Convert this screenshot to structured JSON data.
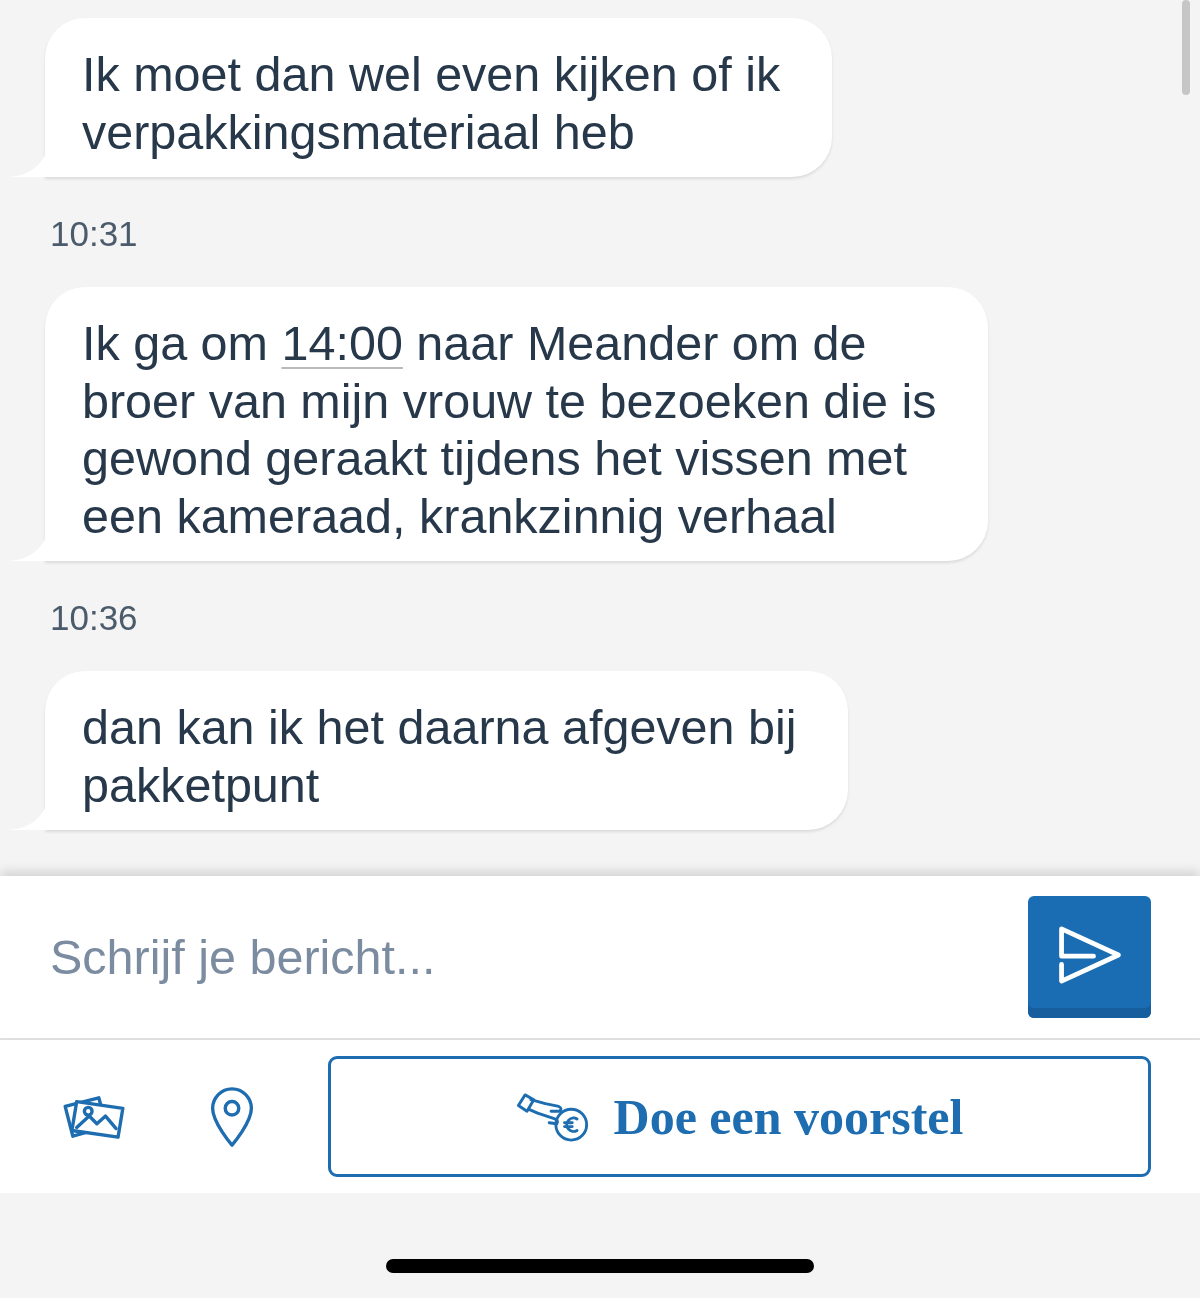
{
  "messages": [
    {
      "kind": "bubble",
      "parts": [
        {
          "kind": "text",
          "text": "Ik moet dan wel even kijken of ik verpakkingsmateriaal heb"
        }
      ]
    },
    {
      "kind": "time",
      "text": "10:31"
    },
    {
      "kind": "bubble",
      "parts": [
        {
          "kind": "text",
          "text": "Ik ga om "
        },
        {
          "kind": "link",
          "text": "14:00"
        },
        {
          "kind": "text",
          "text": " naar Meander om de broer van mijn vrouw te bezoeken die is gewond geraakt tijdens het vissen met een kameraad, krankzinnig verhaal"
        }
      ]
    },
    {
      "kind": "time",
      "text": "10:36"
    },
    {
      "kind": "bubble",
      "parts": [
        {
          "kind": "text",
          "text": "dan kan ik het daarna afgeven bij pakketpunt"
        }
      ]
    }
  ],
  "composer": {
    "placeholder": "Schrijf je bericht..."
  },
  "toolbar": {
    "offer_button": "Doe een voorstel"
  }
}
